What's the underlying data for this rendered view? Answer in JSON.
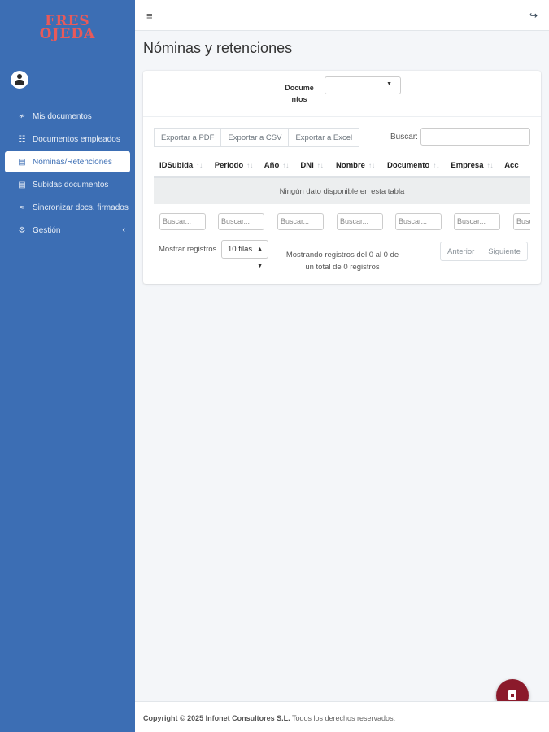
{
  "brand": {
    "logo_line1": "FRES",
    "logo_line2": "OJEDA"
  },
  "sidebar": {
    "items": [
      {
        "label": "Mis documentos",
        "icon": "signature-icon"
      },
      {
        "label": "Documentos empleados",
        "icon": "table-icon"
      },
      {
        "label": "Nóminas/Retenciones",
        "icon": "file-icon",
        "active": true
      },
      {
        "label": "Subidas documentos",
        "icon": "file-icon"
      },
      {
        "label": "Sincronizar docs. firmados",
        "icon": "wifi-icon"
      },
      {
        "label": "Gestión",
        "icon": "gear-icon"
      }
    ]
  },
  "page": {
    "title": "Nóminas y retenciones"
  },
  "filter": {
    "label_line1": "Docume",
    "label_line2": "ntos",
    "selected": ""
  },
  "export_buttons": [
    "Exportar a PDF",
    "Exportar a CSV",
    "Exportar a Excel"
  ],
  "search": {
    "label": "Buscar:"
  },
  "table": {
    "columns": [
      "IDSubida",
      "Periodo",
      "Año",
      "DNI",
      "Nombre",
      "Documento",
      "Empresa",
      "Acc"
    ],
    "empty_message": "Ningún dato disponible en esta tabla",
    "filter_placeholder": "Buscar..."
  },
  "pagination": {
    "length_label": "Mostrar registros",
    "length_value": "10 filas",
    "info_line1": "Mostrando registros del 0 al 0 de",
    "info_line2": "un total de 0 registros",
    "prev": "Anterior",
    "next": "Siguiente"
  },
  "footer": {
    "copyright": "Copyright © 2025 Infonet Consultores S.L.",
    "rights": "Todos los derechos reservados."
  },
  "colors": {
    "sidebar": "#3c6eb4",
    "fab": "#8b1a2b",
    "logo": "#e85a5a"
  }
}
